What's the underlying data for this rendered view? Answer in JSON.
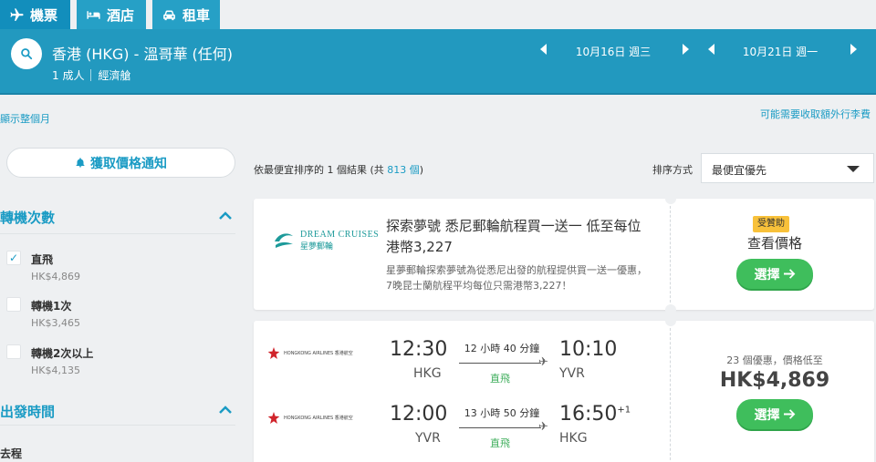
{
  "tabs": [
    {
      "label": "機票",
      "icon": "plane-icon"
    },
    {
      "label": "酒店",
      "icon": "bed-icon"
    },
    {
      "label": "租車",
      "icon": "car-icon"
    }
  ],
  "search": {
    "route": "香港 (HKG) - 溫哥華 (任何)",
    "passengers": "1 成人",
    "cabin": "經濟艙",
    "depart_date": "10月16日 週三",
    "return_date": "10月21日 週一"
  },
  "links": {
    "show_month": "顯示整個月",
    "baggage_fees": "可能需要收取額外行李費"
  },
  "sidebar": {
    "alert_label": "獲取價格通知",
    "stops_title": "轉機次數",
    "stops": [
      {
        "label": "直飛",
        "price": "HK$4,869",
        "checked": true
      },
      {
        "label": "轉機1次",
        "price": "HK$3,465",
        "checked": false
      },
      {
        "label": "轉機2次以上",
        "price": "HK$4,135",
        "checked": false
      }
    ],
    "depart_title": "出發時間",
    "outbound_label": "去程"
  },
  "results": {
    "count_prefix": "依最便宜排序的 1 個結果 (共 ",
    "count_total": "813 個",
    "count_suffix": ")",
    "sort_label": "排序方式",
    "sort_value": "最便宜優先"
  },
  "ad": {
    "logo_line1": "DREAM CRUISES",
    "logo_line2": "星夢郵輪",
    "title": "探索夢號 悉尼郵輪航程買一送一 低至每位港幣3,227",
    "description": "星夢郵輪探索夢號為從悉尼出發的航程提供買一送一優惠，7晚昆士蘭航程平均每位只需港幣3,227！",
    "sponsored": "受贊助",
    "deal_label": "查看價格",
    "button": "選擇"
  },
  "flight": {
    "airline_name": "HONGKONG AIRLINES 香港航空",
    "outbound": {
      "depart": "12:30",
      "from": "HKG",
      "duration": "12 小時 40 分鐘",
      "stops": "直飛",
      "arrive": "10:10",
      "to": "YVR",
      "day_offset": ""
    },
    "inbound": {
      "depart": "12:00",
      "from": "YVR",
      "duration": "13 小時 50 分鐘",
      "stops": "直飛",
      "arrive": "16:50",
      "to": "HKG",
      "day_offset": "+1"
    },
    "offers": "23 個優惠，價格低至",
    "price": "HK$4,869",
    "button": "選擇"
  },
  "colors": {
    "header": "#2299bf",
    "accent": "#1a9bc4",
    "cta": "#3fbe5c",
    "sponsored": "#f8c13a"
  }
}
